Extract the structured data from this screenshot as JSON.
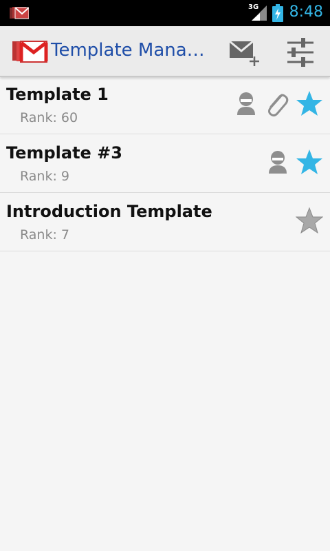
{
  "status_bar": {
    "network_label": "3G",
    "time": "8:48"
  },
  "action_bar": {
    "title": "Template Mana…",
    "actions": [
      {
        "icon": "new-message-icon"
      },
      {
        "icon": "settings-sliders-icon"
      }
    ]
  },
  "templates": [
    {
      "title": "Template 1",
      "rank_label": "Rank:",
      "rank": "60",
      "icons": [
        "person-icon",
        "attachment-icon",
        "star-icon"
      ],
      "starred": true
    },
    {
      "title": "Template #3",
      "rank_label": "Rank:",
      "rank": "9",
      "icons": [
        "person-icon",
        "star-icon"
      ],
      "starred": true
    },
    {
      "title": "Introduction Template",
      "rank_label": "Rank:",
      "rank": "7",
      "icons": [
        "star-icon"
      ],
      "starred": false
    }
  ],
  "colors": {
    "accent": "#33b5e5",
    "title_blue": "#1f4ea8",
    "star_on": "#33b5e5",
    "star_off": "#9e9e9e",
    "icon_gray": "#8e8e8e"
  }
}
